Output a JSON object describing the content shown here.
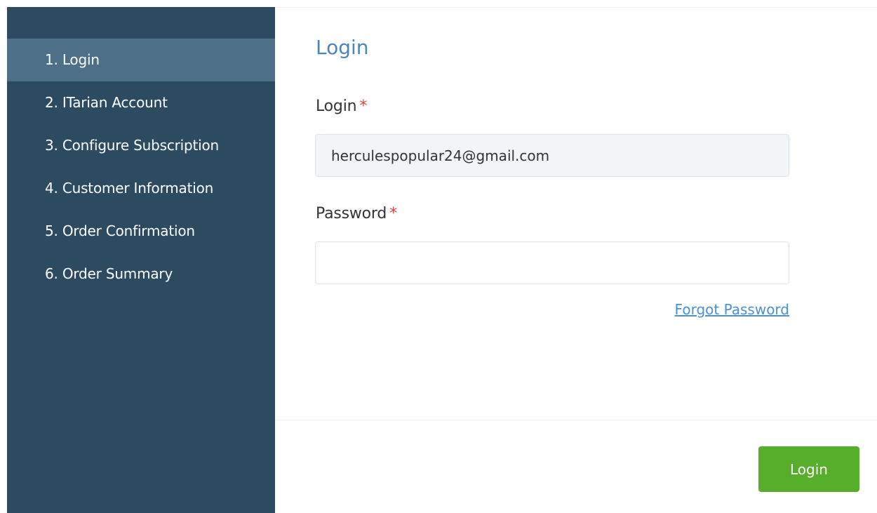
{
  "sidebar": {
    "steps": [
      {
        "label": "1. Login"
      },
      {
        "label": "2. ITarian Account"
      },
      {
        "label": "3. Configure Subscription"
      },
      {
        "label": "4. Customer Information"
      },
      {
        "label": "5. Order Confirmation"
      },
      {
        "label": "6. Order Summary"
      }
    ],
    "active_step": "1. Login"
  },
  "form": {
    "title": "Login",
    "login_label": "Login",
    "login_value": "herculespopular24@gmail.com",
    "password_label": "Password",
    "password_value": "",
    "required_marker": "*",
    "forgot_password": "Forgot Password",
    "submit_label": "Login"
  },
  "colors": {
    "sidebar_bg": "#2c4a60",
    "sidebar_active": "#4d6f88",
    "title_blue": "#4e86b8",
    "link_blue": "#4a90d9",
    "required_red": "#e04444",
    "button_green": "#56ae2a"
  }
}
